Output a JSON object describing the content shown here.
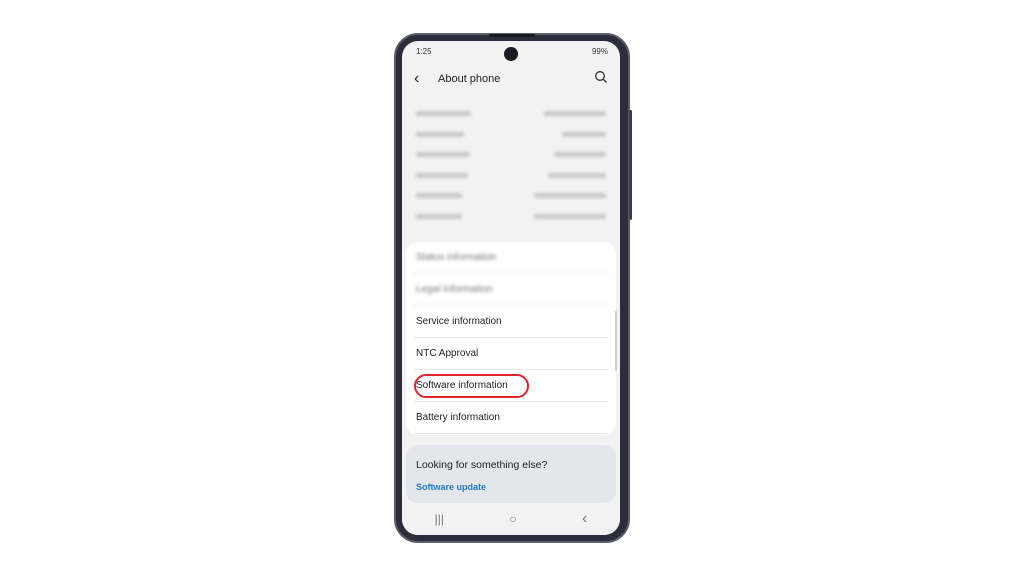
{
  "status_bar": {
    "time": "1:25",
    "battery": "99%"
  },
  "header": {
    "title": "About phone",
    "back_icon": "chevron-left-icon",
    "search_icon": "search-icon"
  },
  "menu": {
    "items": [
      {
        "label": "Status information",
        "blurred": true
      },
      {
        "label": "Legal information",
        "blurred": true
      },
      {
        "label": "Service information",
        "blurred": false
      },
      {
        "label": "NTC Approval",
        "blurred": false
      },
      {
        "label": "Software information",
        "blurred": false,
        "highlighted": true
      },
      {
        "label": "Battery information",
        "blurred": false
      }
    ]
  },
  "help": {
    "question": "Looking for something else?",
    "link": "Software update"
  },
  "highlight_color": "#e0242b",
  "nav": {
    "recents": "|||",
    "home": "○",
    "back": "‹"
  }
}
